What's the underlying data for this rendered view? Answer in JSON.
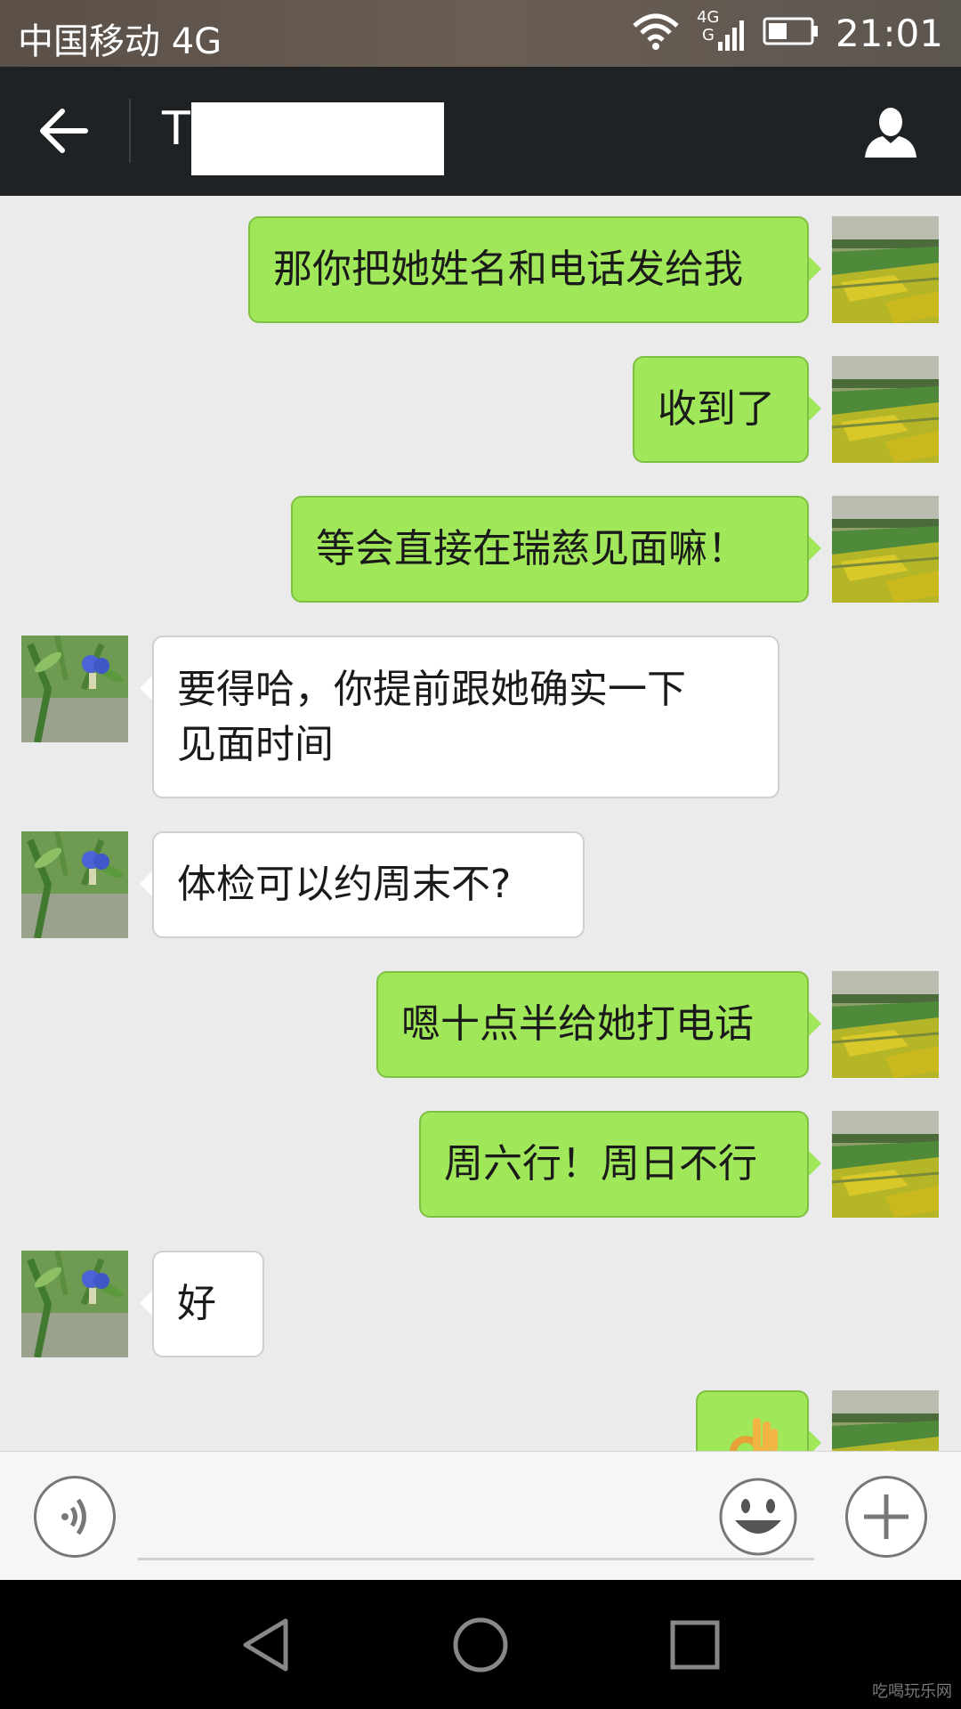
{
  "status_bar": {
    "carrier": "中国移动 4G",
    "network_label": "4G",
    "network_sub": "G",
    "time": "21:01"
  },
  "header": {
    "title_initial": "T"
  },
  "messages": [
    {
      "dir": "out",
      "text": "那你把她姓名和电话发给我"
    },
    {
      "dir": "out",
      "text": "收到了"
    },
    {
      "dir": "out",
      "text": "等会直接在瑞慈见面嘛！"
    },
    {
      "dir": "in",
      "text": "要得哈，你提前跟她确实一下",
      "text2": "见面时间"
    },
    {
      "dir": "in",
      "text": "体检可以约周末不?"
    },
    {
      "dir": "out",
      "text": "嗯十点半给她打电话"
    },
    {
      "dir": "out",
      "text": "周六行！周日不行"
    },
    {
      "dir": "in",
      "text": "好"
    },
    {
      "dir": "out",
      "emoji": "ok-hand-emoji"
    }
  ],
  "input_bar": {
    "voice_icon": "voice-icon",
    "emoji_icon": "smiley-icon",
    "more_icon": "plus-icon"
  },
  "nav_bar": {
    "back": "triangle-back-icon",
    "home": "circle-home-icon",
    "recents": "square-recents-icon"
  },
  "watermark": "吃喝玩乐网"
}
